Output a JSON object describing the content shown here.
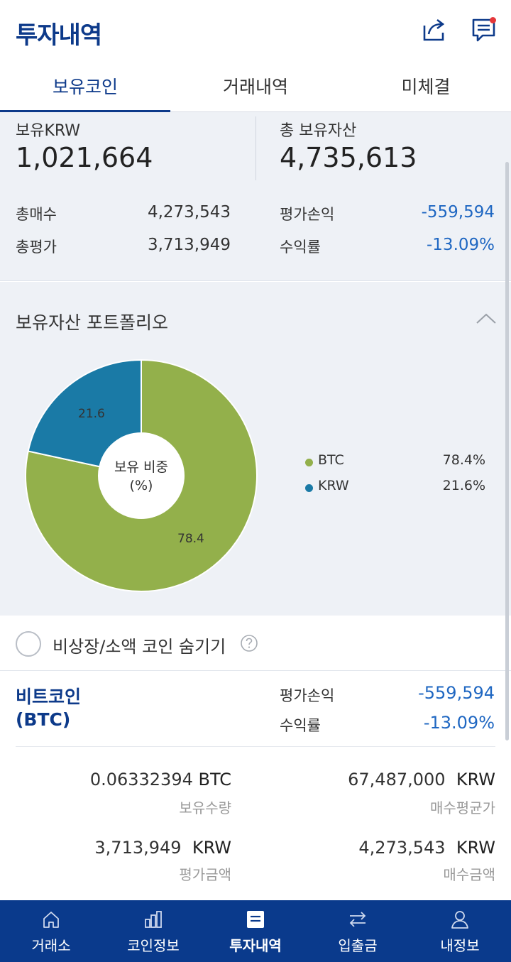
{
  "header": {
    "title": "투자내역",
    "icons": [
      "share-icon",
      "chat-icon"
    ],
    "notification_color": "#e5373a"
  },
  "tabs": [
    {
      "label": "보유코인",
      "active": true
    },
    {
      "label": "거래내역",
      "active": false
    },
    {
      "label": "미체결",
      "active": false
    }
  ],
  "summary": {
    "krw_label": "보유KRW",
    "krw_value": "1,021,664",
    "total_label": "총 보유자산",
    "total_value": "4,735,613",
    "buy_total_label": "총매수",
    "buy_total_value": "4,273,543",
    "eval_total_label": "총평가",
    "eval_total_value": "3,713,949",
    "pnl_label": "평가손익",
    "pnl_value": "-559,594",
    "rate_label": "수익률",
    "rate_value": "-13.09%"
  },
  "portfolio": {
    "title": "보유자산 포트폴리오",
    "collapse_icon": "chevron-up-icon",
    "center_line1": "보유 비중",
    "center_line2": "(%)",
    "slice_labels": {
      "btc": "78.4",
      "krw": "21.6"
    },
    "legend": [
      {
        "name": "BTC",
        "value": "78.4%",
        "color": "#93b04b"
      },
      {
        "name": "KRW",
        "value": "21.6%",
        "color": "#1a7aa6"
      }
    ]
  },
  "chart_data": {
    "type": "pie",
    "categories": [
      "BTC",
      "KRW"
    ],
    "values": [
      78.4,
      21.6
    ],
    "colors": [
      "#93b04b",
      "#1a7aa6"
    ],
    "donut": true,
    "legend": "right"
  },
  "filter": {
    "label": "비상장/소액 코인 숨기기",
    "help_icon": "question-icon",
    "checked": false
  },
  "coin": {
    "name_line1": "비트코인",
    "name_line2": "(BTC)",
    "pnl_label": "평가손익",
    "pnl_value": "-559,594",
    "rate_label": "수익률",
    "rate_value": "-13.09%",
    "qty_value": "0.06332394",
    "qty_unit": "BTC",
    "qty_label": "보유수량",
    "avg_value": "67,487,000",
    "avg_unit": "KRW",
    "avg_label": "매수평균가",
    "eval_value": "3,713,949",
    "eval_unit": "KRW",
    "eval_label": "평가금액",
    "buy_value": "4,273,543",
    "buy_unit": "KRW",
    "buy_label": "매수금액"
  },
  "bottomnav": [
    {
      "label": "거래소",
      "icon": "home-icon",
      "active": false
    },
    {
      "label": "코인정보",
      "icon": "bar-chart-icon",
      "active": false
    },
    {
      "label": "투자내역",
      "icon": "document-icon",
      "active": true
    },
    {
      "label": "입출금",
      "icon": "transfer-icon",
      "active": false
    },
    {
      "label": "내정보",
      "icon": "user-icon",
      "active": false
    }
  ],
  "colors": {
    "brand": "#0d3a8a",
    "nav_bg": "#0a3a8c",
    "negative": "#1f67c2",
    "panel_bg": "#eef1f6"
  }
}
